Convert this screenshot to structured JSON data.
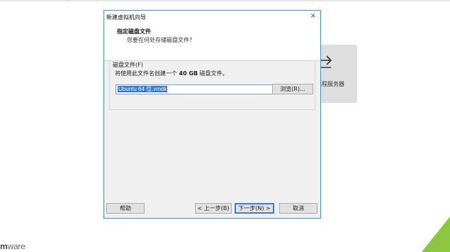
{
  "dialog": {
    "title": "新建虚拟机向导",
    "close_glyph": "×",
    "header_title": "指定磁盘文件",
    "header_subtitle": "您要在何处存储磁盘文件?",
    "group_label": "磁盘文件(F)",
    "desc_prefix": "将使用此文件名创建一个 ",
    "desc_size": "40 GB",
    "desc_suffix": " 磁盘文件。",
    "file_value": "Ubuntu 64 位.vmdk",
    "browse_label": "浏览(R)...",
    "buttons": {
      "help": "帮助",
      "back": "< 上一步(B)",
      "next": "下一步(N) >",
      "cancel": "取消"
    }
  },
  "background": {
    "card_label": "远程服务器",
    "card_icon": "arrow-right-icon",
    "logo_prefix": "m",
    "logo_suffix": "ware",
    "accent": "#8dc63f"
  }
}
